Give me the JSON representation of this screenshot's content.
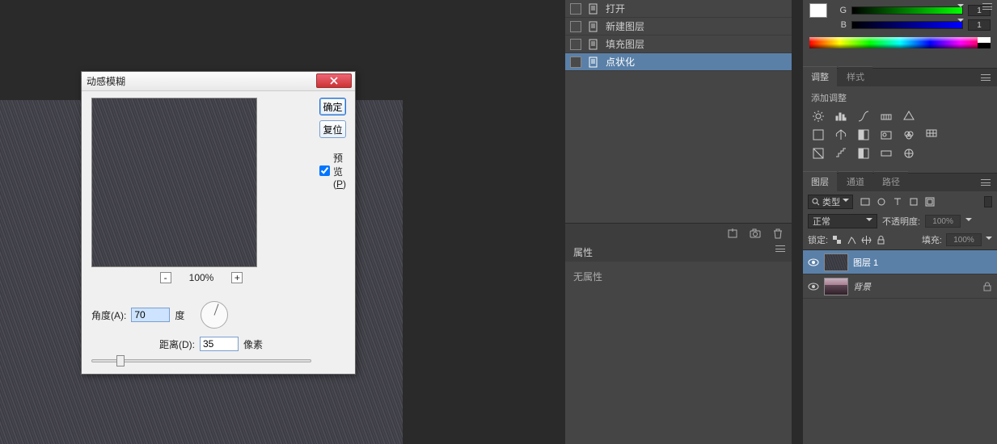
{
  "canvas": {},
  "dialog": {
    "title": "动感模糊",
    "ok": "确定",
    "reset": "复位",
    "preview_label": "预览(P)",
    "preview_checked": true,
    "zoom": "100%",
    "angle_label": "角度(A):",
    "angle_value": "70",
    "angle_unit": "度",
    "distance_label": "距离(D):",
    "distance_value": "35",
    "distance_unit": "像素"
  },
  "history": {
    "items": [
      {
        "label": "打开"
      },
      {
        "label": "新建图层"
      },
      {
        "label": "填充图层"
      },
      {
        "label": "点状化",
        "selected": true
      }
    ]
  },
  "properties": {
    "tab": "属性",
    "empty": "无属性"
  },
  "color": {
    "g_label": "G",
    "b_label": "B",
    "g_value": "1",
    "b_value": "1"
  },
  "adjustments": {
    "tab_active": "调整",
    "tab_inactive": "样式",
    "title": "添加调整"
  },
  "layers": {
    "tab_layers": "图层",
    "tab_channels": "通道",
    "tab_paths": "路径",
    "kind_label": "类型",
    "blend_mode": "正常",
    "opacity_label": "不透明度:",
    "opacity_value": "100%",
    "lock_label": "锁定:",
    "fill_label": "填充:",
    "fill_value": "100%",
    "items": [
      {
        "name": "图层 1",
        "selected": true,
        "thumb": "tex"
      },
      {
        "name": "背景",
        "selected": false,
        "thumb": "bg",
        "locked": true,
        "italic": true
      }
    ]
  }
}
